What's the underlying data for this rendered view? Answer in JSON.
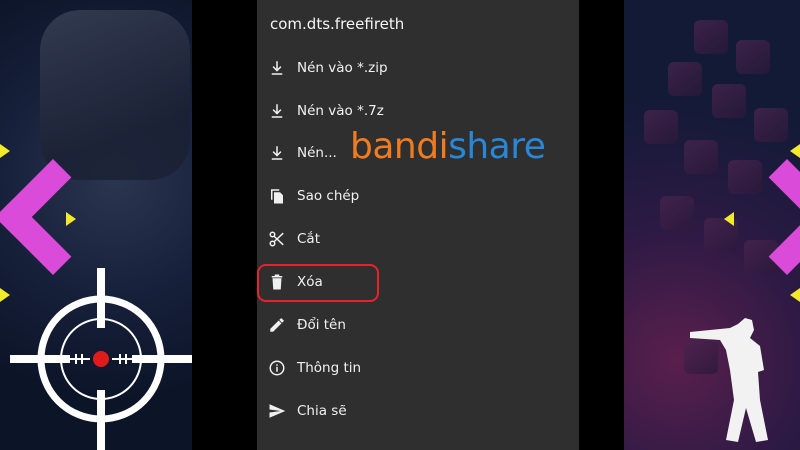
{
  "menu": {
    "title": "com.dts.freefireth",
    "items": [
      {
        "label": "Nén vào *.zip",
        "icon": "download-icon"
      },
      {
        "label": "Nén vào *.7z",
        "icon": "download-icon"
      },
      {
        "label": "Nén...",
        "icon": "download-icon"
      },
      {
        "label": "Sao chép",
        "icon": "copy-icon"
      },
      {
        "label": "Cắt",
        "icon": "scissors-icon"
      },
      {
        "label": "Xóa",
        "icon": "trash-icon"
      },
      {
        "label": "Đổi tên",
        "icon": "pencil-icon"
      },
      {
        "label": "Thông tin",
        "icon": "info-icon"
      },
      {
        "label": "Chia sẽ",
        "icon": "share-icon"
      }
    ]
  },
  "watermark": {
    "part1": "bandi",
    "part2": "share"
  },
  "colors": {
    "menu_bg": "#2f2f2f",
    "highlight": "#e8222a",
    "accent_pink": "#d94bd8",
    "accent_yellow": "#f2ea2a",
    "brand_orange": "#f07c22",
    "brand_blue": "#2a86d6"
  }
}
